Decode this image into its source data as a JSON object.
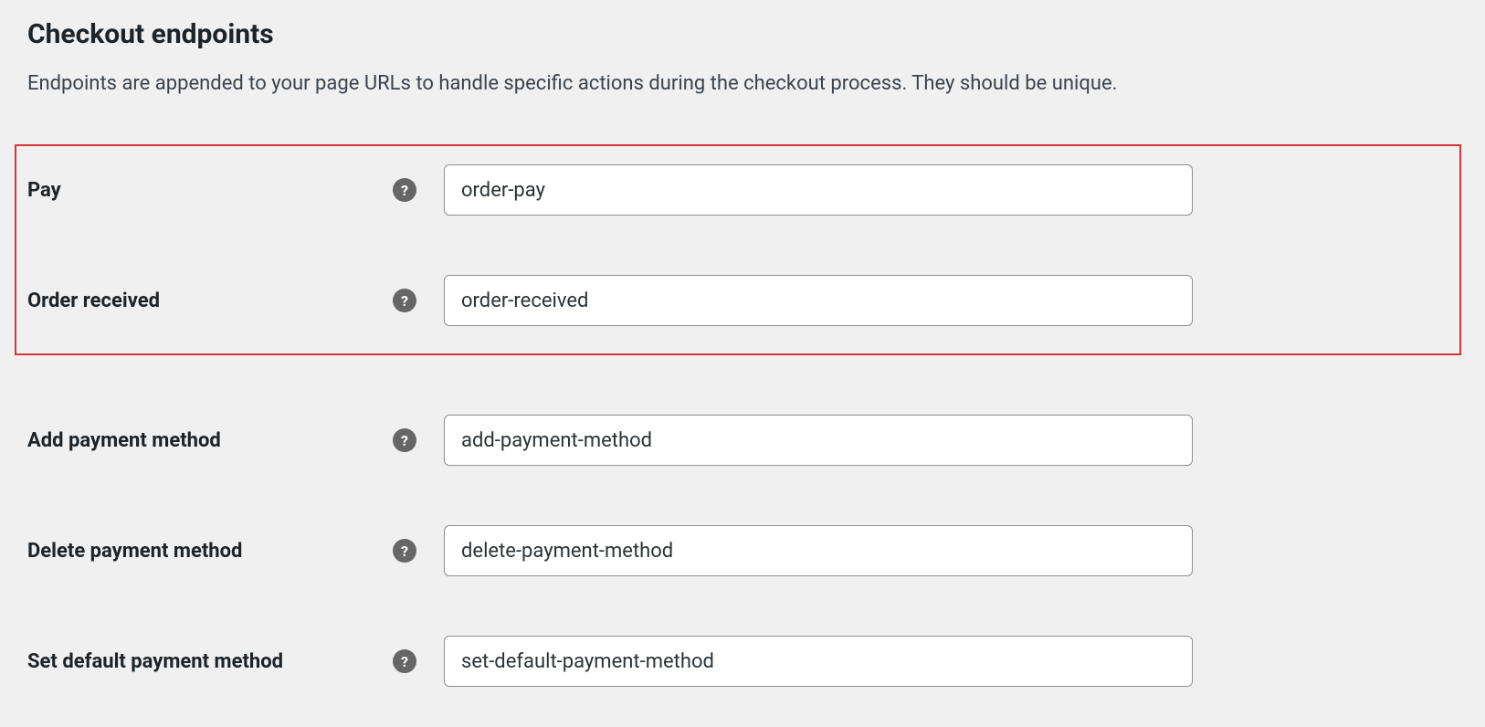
{
  "section": {
    "title": "Checkout endpoints",
    "description": "Endpoints are appended to your page URLs to handle specific actions during the checkout process. They should be unique."
  },
  "fields": {
    "pay": {
      "label": "Pay",
      "value": "order-pay"
    },
    "order_received": {
      "label": "Order received",
      "value": "order-received"
    },
    "add_payment_method": {
      "label": "Add payment method",
      "value": "add-payment-method"
    },
    "delete_payment_method": {
      "label": "Delete payment method",
      "value": "delete-payment-method"
    },
    "set_default_payment_method": {
      "label": "Set default payment method",
      "value": "set-default-payment-method"
    }
  }
}
